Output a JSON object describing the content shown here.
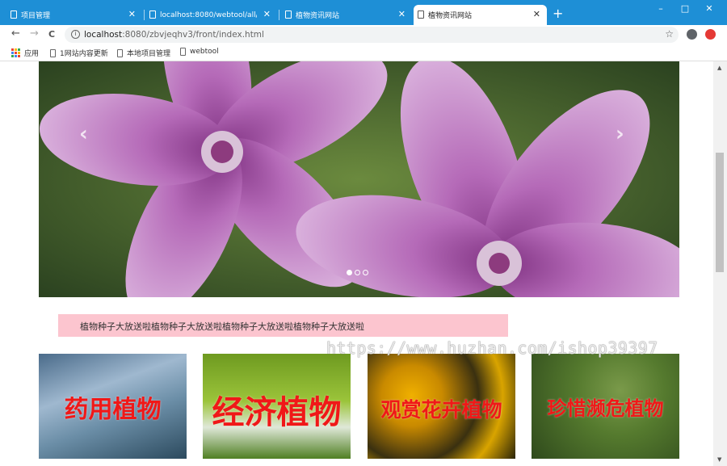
{
  "browser": {
    "tabs": [
      {
        "title": "项目管理",
        "active": false
      },
      {
        "title": "localhost:8080/webtool/all/in…",
        "active": false
      },
      {
        "title": "植物资讯网站",
        "active": false
      },
      {
        "title": "植物资讯网站",
        "active": true
      }
    ],
    "new_tab_symbol": "+",
    "window_controls": {
      "minimize": "–",
      "maximize": "□",
      "close": "✕"
    },
    "nav": {
      "back": "←",
      "forward": "→",
      "reload": "C"
    },
    "address": {
      "host": "localhost",
      "path": ":8080/zbvjeqhv3/front/index.html",
      "info_icon": "i",
      "star_icon": "☆"
    },
    "bookmarks": [
      {
        "label": "应用",
        "icon": "apps-grid-icon"
      },
      {
        "label": "1网站内容更新",
        "icon": "page-icon"
      },
      {
        "label": "本地项目管理",
        "icon": "page-icon"
      },
      {
        "label": "webtool",
        "icon": "page-icon"
      }
    ],
    "accent_color": "#1e8fd6"
  },
  "page": {
    "carousel": {
      "prev_symbol": "‹",
      "next_symbol": "›",
      "slide_count": 3,
      "active_slide": 1
    },
    "notice": "植物种子大放送啦植物种子大放送啦植物种子大放送啦植物种子大放送啦",
    "categories": [
      {
        "label": "药用植物"
      },
      {
        "label": "经济植物"
      },
      {
        "label": "观赏花卉植物"
      },
      {
        "label": "珍惜濒危植物"
      }
    ],
    "watermark": "https://www.huzhan.com/ishop39397"
  },
  "colors": {
    "notice_bg": "#fcc5cf",
    "category_text": "#f01818"
  }
}
